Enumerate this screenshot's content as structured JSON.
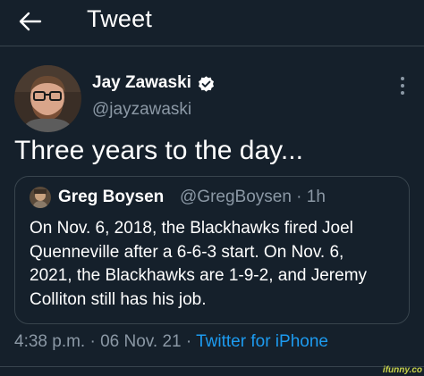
{
  "header": {
    "title": "Tweet",
    "back_icon": "arrow-left-icon"
  },
  "author": {
    "name": "Jay Zawaski",
    "handle": "@jayzawaski",
    "verified_icon": "verified-badge-icon",
    "more_icon": "more-vertical-icon"
  },
  "tweet": {
    "text": "Three years to the day..."
  },
  "quote": {
    "name": "Greg Boysen",
    "handle_line": "@GregBoysen · 1h",
    "lines": [
      "On Nov. 6, 2018, the Blackhawks fired Joel",
      "Quenneville after a 6-6-3 start. On Nov. 6,",
      "2021, the Blackhawks are 1-9-2, and Jeremy",
      "Colliton still has his job."
    ]
  },
  "meta": {
    "time_date": "4:38 p.m. · 06 Nov. 21 · ",
    "source": "Twitter for iPhone"
  },
  "watermark": "ifunny.co",
  "colors": {
    "background": "#15202b",
    "text": "#ffffff",
    "secondary": "#8b98a5",
    "accent": "#1d9bf0",
    "border": "#38444d"
  }
}
